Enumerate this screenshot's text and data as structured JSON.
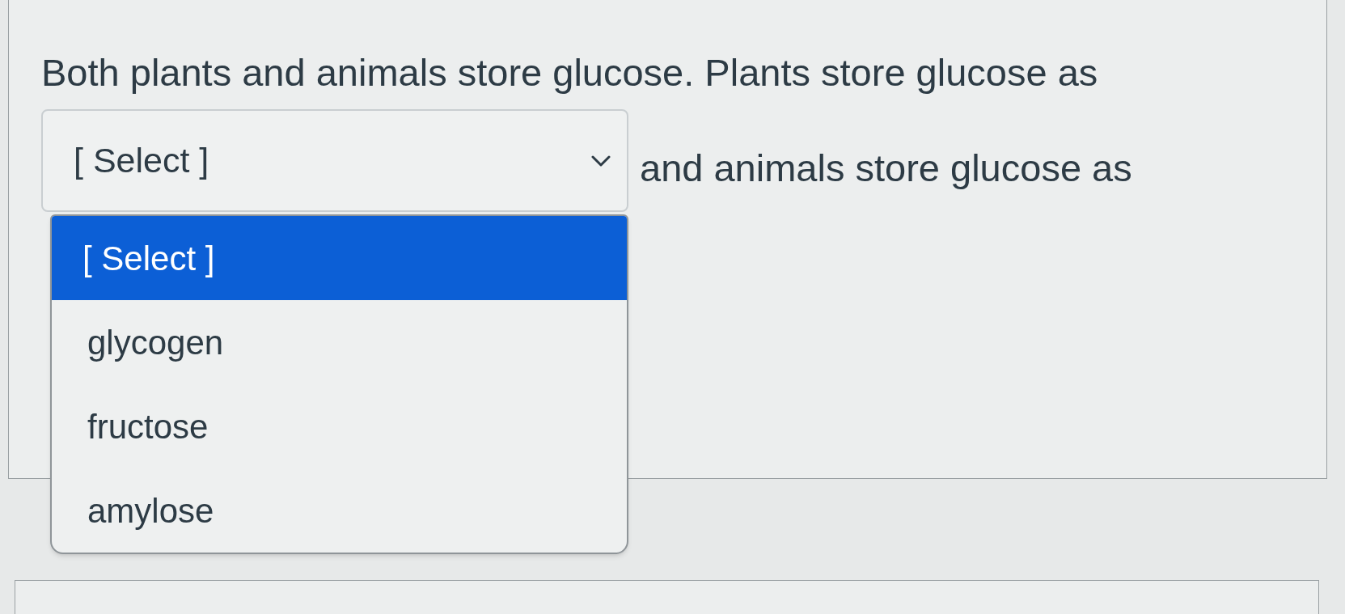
{
  "question": {
    "text_before": "Both plants and animals store glucose. Plants store glucose as",
    "text_after": "and animals store glucose as"
  },
  "dropdown": {
    "value": "[ Select ]",
    "expanded": true,
    "options": [
      {
        "label": "[ Select ]",
        "selected": true
      },
      {
        "label": "glycogen",
        "selected": false
      },
      {
        "label": "fructose",
        "selected": false
      },
      {
        "label": "amylose",
        "selected": false
      }
    ]
  }
}
